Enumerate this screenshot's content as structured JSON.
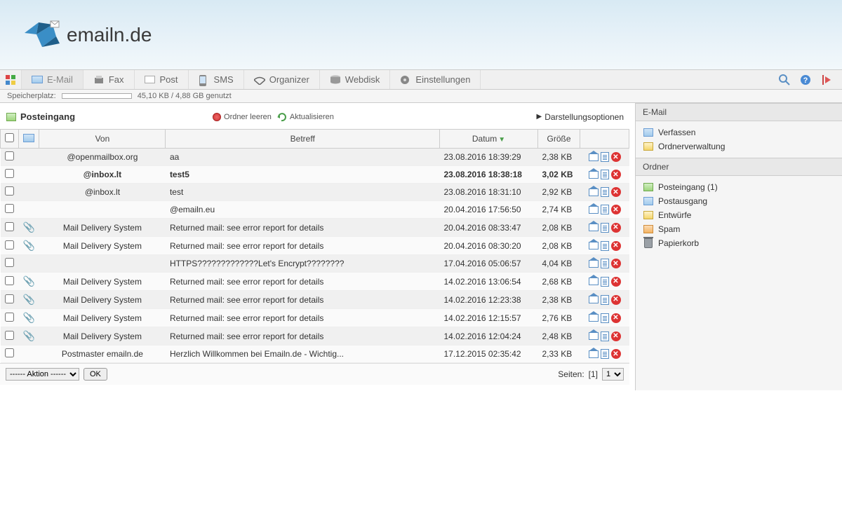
{
  "logo_text": "emailn.de",
  "nav": {
    "items": [
      {
        "label": "E-Mail",
        "active": true,
        "icon": "mail"
      },
      {
        "label": "Fax",
        "icon": "fax"
      },
      {
        "label": "Post",
        "icon": "post"
      },
      {
        "label": "SMS",
        "icon": "sms"
      },
      {
        "label": "Organizer",
        "icon": "organizer"
      },
      {
        "label": "Webdisk",
        "icon": "webdisk"
      },
      {
        "label": "Einstellungen",
        "icon": "settings"
      }
    ]
  },
  "storage": {
    "label": "Speicherplatz:",
    "text": "45,10 KB / 4,88 GB genutzt"
  },
  "toolbar": {
    "title": "Posteingang",
    "empty_folder": "Ordner leeren",
    "refresh": "Aktualisieren",
    "display_options": "Darstellungsoptionen"
  },
  "columns": {
    "from": "Von",
    "subject": "Betreff",
    "date": "Datum",
    "size": "Größe"
  },
  "mails": [
    {
      "from": "@openmailbox.org",
      "subject": "aa",
      "date": "23.08.2016 18:39:29",
      "size": "2,38 KB",
      "attach": false,
      "bold": false
    },
    {
      "from": "@inbox.lt",
      "subject": "test5",
      "date": "23.08.2016 18:38:18",
      "size": "3,02 KB",
      "attach": false,
      "bold": true
    },
    {
      "from": "@inbox.lt",
      "subject": "test",
      "date": "23.08.2016 18:31:10",
      "size": "2,92 KB",
      "attach": false,
      "bold": false
    },
    {
      "from": "",
      "subject": "@emailn.eu",
      "date": "20.04.2016 17:56:50",
      "size": "2,74 KB",
      "attach": false,
      "bold": false
    },
    {
      "from": "Mail Delivery System",
      "subject": "Returned mail: see error report for details",
      "date": "20.04.2016 08:33:47",
      "size": "2,08 KB",
      "attach": true,
      "bold": false
    },
    {
      "from": "Mail Delivery System",
      "subject": "Returned mail: see error report for details",
      "date": "20.04.2016 08:30:20",
      "size": "2,08 KB",
      "attach": true,
      "bold": false
    },
    {
      "from": "",
      "subject": "HTTPS?????????????Let's Encrypt????????",
      "date": "17.04.2016 05:06:57",
      "size": "4,04 KB",
      "attach": false,
      "bold": false
    },
    {
      "from": "Mail Delivery System",
      "subject": "Returned mail: see error report for details",
      "date": "14.02.2016 13:06:54",
      "size": "2,68 KB",
      "attach": true,
      "bold": false
    },
    {
      "from": "Mail Delivery System",
      "subject": "Returned mail: see error report for details",
      "date": "14.02.2016 12:23:38",
      "size": "2,38 KB",
      "attach": true,
      "bold": false
    },
    {
      "from": "Mail Delivery System",
      "subject": "Returned mail: see error report for details",
      "date": "14.02.2016 12:15:57",
      "size": "2,76 KB",
      "attach": true,
      "bold": false
    },
    {
      "from": "Mail Delivery System",
      "subject": "Returned mail: see error report for details",
      "date": "14.02.2016 12:04:24",
      "size": "2,48 KB",
      "attach": true,
      "bold": false
    },
    {
      "from": "Postmaster emailn.de",
      "subject": "Herzlich Willkommen bei Emailn.de - Wichtig...",
      "date": "17.12.2015 02:35:42",
      "size": "2,33 KB",
      "attach": false,
      "bold": false
    }
  ],
  "bottom": {
    "action_placeholder": "------ Aktion ------",
    "ok": "OK",
    "pages_label": "Seiten:",
    "current_page": "[1]",
    "page_select": "1"
  },
  "sidebar": {
    "section1_title": "E-Mail",
    "compose": "Verfassen",
    "folder_admin": "Ordnerverwaltung",
    "section2_title": "Ordner",
    "folders": [
      {
        "label": "Posteingang (1)",
        "icon": "green"
      },
      {
        "label": "Postausgang",
        "icon": "blue"
      },
      {
        "label": "Entwürfe",
        "icon": "yellow"
      },
      {
        "label": "Spam",
        "icon": "orange"
      },
      {
        "label": "Papierkorb",
        "icon": "trash"
      }
    ]
  }
}
